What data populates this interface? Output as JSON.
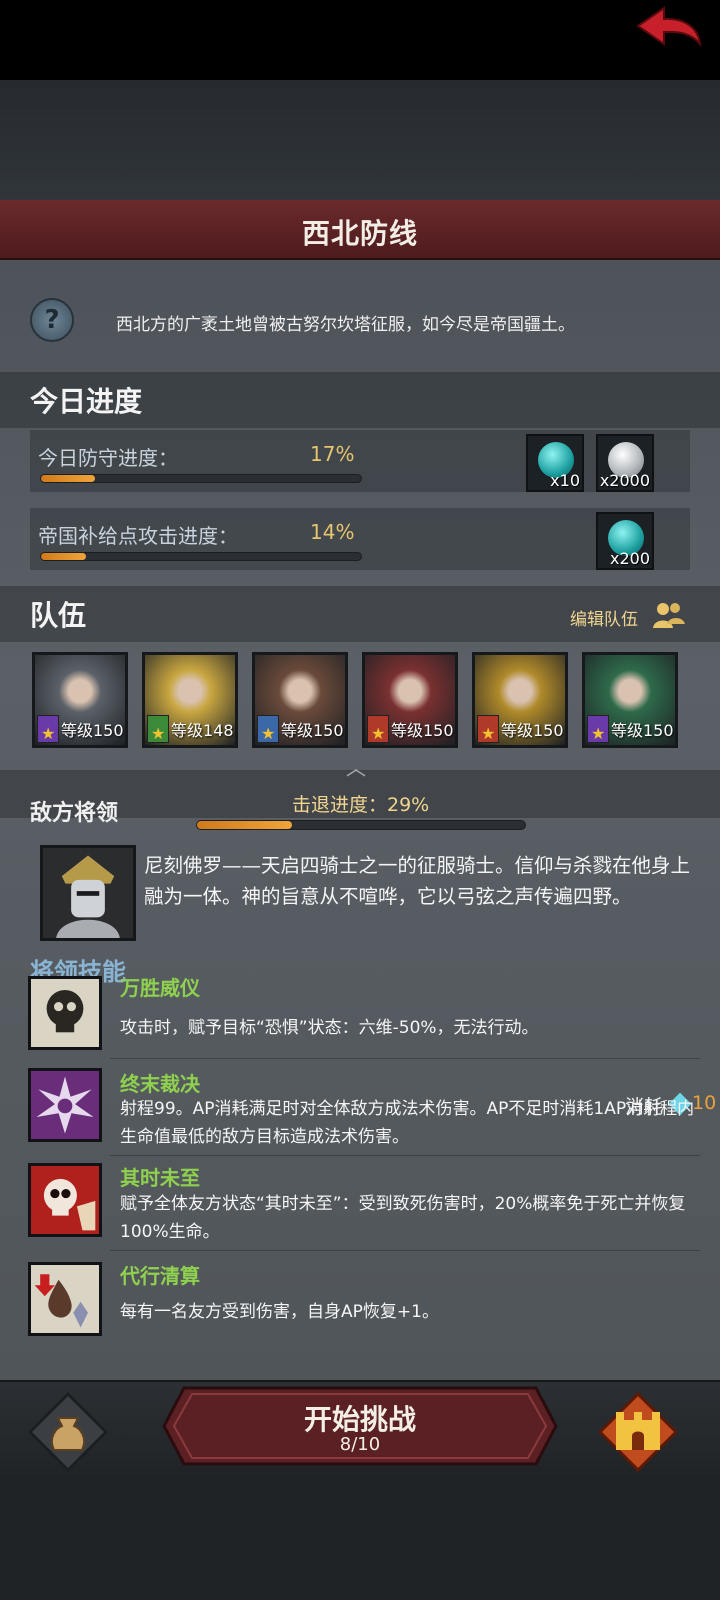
{
  "header": {
    "title": "西北防线"
  },
  "description": "西北方的广袤土地曾被古努尔坎塔征服，如今尽是帝国疆土。",
  "progress_section": {
    "title": "今日进度",
    "rows": [
      {
        "label": "今日防守进度：",
        "percent_text": "17%",
        "percent": 17,
        "rewards": [
          {
            "icon": "teal-gem-icon",
            "qty": "x10"
          },
          {
            "icon": "silver-coin-icon",
            "qty": "x2000"
          }
        ]
      },
      {
        "label": "帝国补给点攻击进度：",
        "percent_text": "14%",
        "percent": 14,
        "rewards": [
          {
            "icon": "teal-gem-icon",
            "qty": "x200"
          }
        ]
      }
    ]
  },
  "team_section": {
    "title": "队伍",
    "edit_label": "编辑队伍",
    "heroes": [
      {
        "level": "等级150",
        "class_color": "#6a3aa8",
        "tint": "#5b6168"
      },
      {
        "level": "等级148",
        "class_color": "#3a8a3a",
        "tint": "#c8a640"
      },
      {
        "level": "等级150",
        "class_color": "#3a68a8",
        "tint": "#6a4a3a"
      },
      {
        "level": "等级150",
        "class_color": "#b03a2a",
        "tint": "#7a3030"
      },
      {
        "level": "等级150",
        "class_color": "#b03a2a",
        "tint": "#b08a2a"
      },
      {
        "level": "等级150",
        "class_color": "#6a3aa8",
        "tint": "#2e6a4a"
      }
    ]
  },
  "enemy_section": {
    "title": "敌方将领",
    "repel_label": "击退进度：29%",
    "repel_percent": 29,
    "description": "尼刻佛罗——天启四骑士之一的征服骑士。信仰与杀戮在他身上融为一体。神的旨意从不喧哗，它以弓弦之声传遍四野。"
  },
  "skills_section": {
    "title": "将领技能",
    "skills": [
      {
        "name": "万胜威仪",
        "desc": "攻击时，赋予目标“恐惧”状态：六维-50%，无法行动。",
        "icon": "skull-icon",
        "color": "#d9d4c4"
      },
      {
        "name": "终末裁决",
        "desc": "射程99。AP消耗满足时对全体敌方成法术伤害。AP不足时消耗1AP对射程内生命值最低的敌方目标造成法术伤害。",
        "icon": "burst-icon",
        "color": "#6a2d7a"
      },
      {
        "name": "其时未至",
        "desc": "赋予全体友方状态“其时未至”：受到致死伤害时，20%概率免于死亡并恢复100%生命。",
        "icon": "red-skull-icon",
        "color": "#b0201c"
      },
      {
        "name": "代行清算",
        "desc": "每有一名友方受到伤害，自身AP恢复+1。",
        "icon": "drop-icon",
        "color": "#d9d4c4"
      }
    ],
    "cost_label": "消耗",
    "cost_value": "10"
  },
  "bottom": {
    "start_label": "开始挑战",
    "attempts": "8/10"
  }
}
